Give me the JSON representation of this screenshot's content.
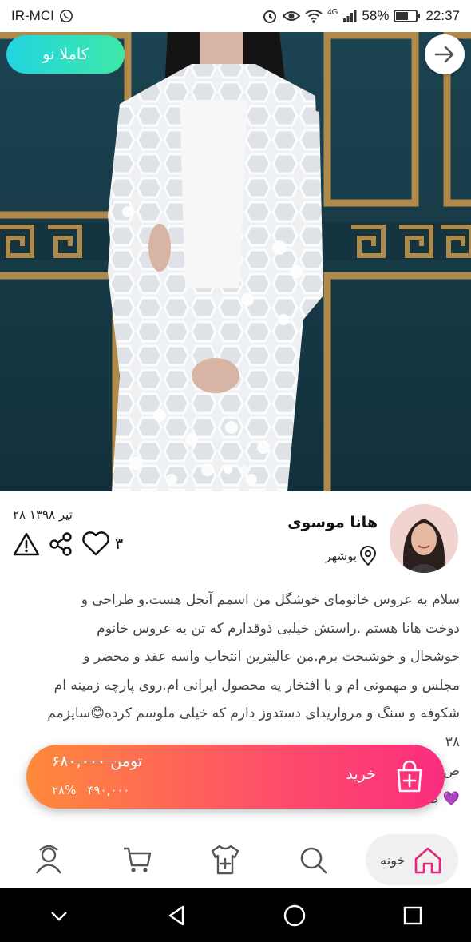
{
  "status_bar": {
    "carrier": "IR-MCI",
    "network": "4G",
    "battery": "58%",
    "time": "22:37"
  },
  "hero": {
    "badge": "کاملا نو",
    "slides": 2,
    "active_slide": 1
  },
  "seller": {
    "name": "هانا موسوی",
    "city": "بوشهر",
    "date": "۲۸ تیر ۱۳۹۸",
    "likes": "۳"
  },
  "description": {
    "lines": [
      "سلام به عروس خانومای خوشگل من اسمم آنجل هست.و طراحی و",
      "دوخت هانا هستم .راستش خیلیی ذوقدارم که تن یه عروس خانوم",
      "خوشحال و خوشبخت برم.من عالیترین انتخاب واسه عقد و محضر و",
      "مجلس و مهمونی ام و با افتخار یه محصول ایرانی ام.روی پارچه زمینه ام",
      "شکوفه و سنگ و مرواریدای دستدوز دارم که خیلی ملوسم کرده😊سایزمم",
      "۳۸",
      "ص",
      "💜 ضمنا این مانتو یه اکسسوری سورپرایزی هم داره 💜"
    ]
  },
  "buy_bar": {
    "label": "خرید",
    "old_price": "۶۸۰,۰۰۰ تومن",
    "new_price": "۴۹۰,۰۰۰",
    "discount": "۲۸%"
  },
  "bottom_nav": {
    "home_label": "خونه"
  },
  "colors": {
    "badge_start": "#21d4e0",
    "badge_end": "#3ee8a7",
    "buy_start": "#fe8a3a",
    "buy_end": "#fb2d7e",
    "home_icon": "#e0287c"
  }
}
